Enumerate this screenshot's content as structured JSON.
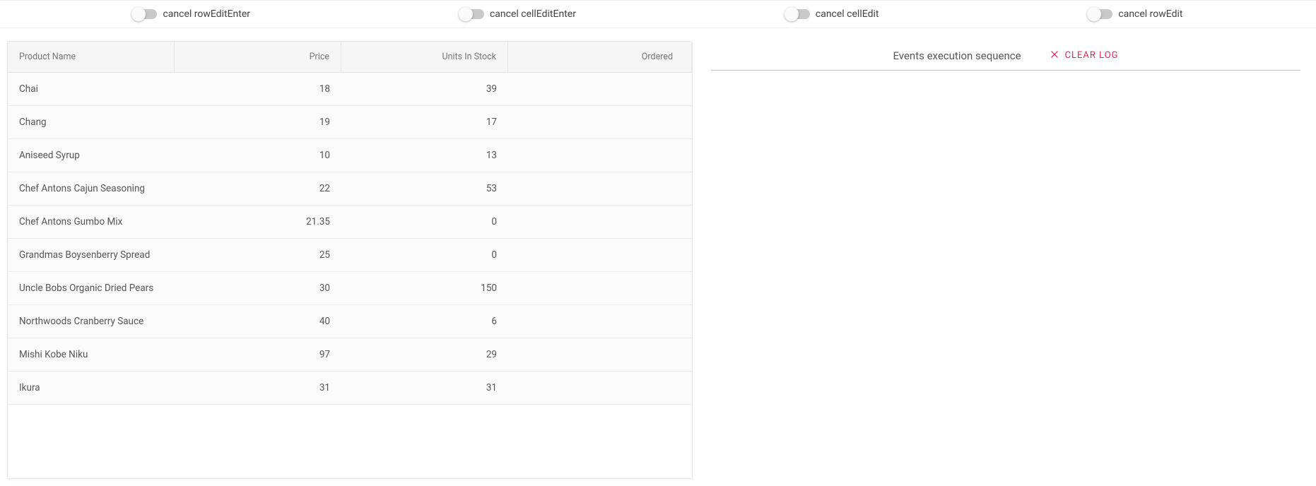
{
  "toggles": [
    {
      "label": "cancel rowEditEnter"
    },
    {
      "label": "cancel cellEditEnter"
    },
    {
      "label": "cancel cellEdit"
    },
    {
      "label": "cancel rowEdit"
    }
  ],
  "grid": {
    "columns": {
      "name": "Product Name",
      "price": "Price",
      "stock": "Units In Stock",
      "ordered": "Ordered"
    },
    "rows": [
      {
        "name": "Chai",
        "price": "18",
        "stock": "39",
        "ordered": ""
      },
      {
        "name": "Chang",
        "price": "19",
        "stock": "17",
        "ordered": ""
      },
      {
        "name": "Aniseed Syrup",
        "price": "10",
        "stock": "13",
        "ordered": ""
      },
      {
        "name": "Chef Antons Cajun Seasoning",
        "price": "22",
        "stock": "53",
        "ordered": ""
      },
      {
        "name": "Chef Antons Gumbo Mix",
        "price": "21.35",
        "stock": "0",
        "ordered": ""
      },
      {
        "name": "Grandmas Boysenberry Spread",
        "price": "25",
        "stock": "0",
        "ordered": ""
      },
      {
        "name": "Uncle Bobs Organic Dried Pears",
        "price": "30",
        "stock": "150",
        "ordered": ""
      },
      {
        "name": "Northwoods Cranberry Sauce",
        "price": "40",
        "stock": "6",
        "ordered": ""
      },
      {
        "name": "Mishi Kobe Niku",
        "price": "97",
        "stock": "29",
        "ordered": ""
      },
      {
        "name": "Ikura",
        "price": "31",
        "stock": "31",
        "ordered": ""
      }
    ]
  },
  "log": {
    "title": "Events execution sequence",
    "clear_label": "CLEAR LOG"
  }
}
